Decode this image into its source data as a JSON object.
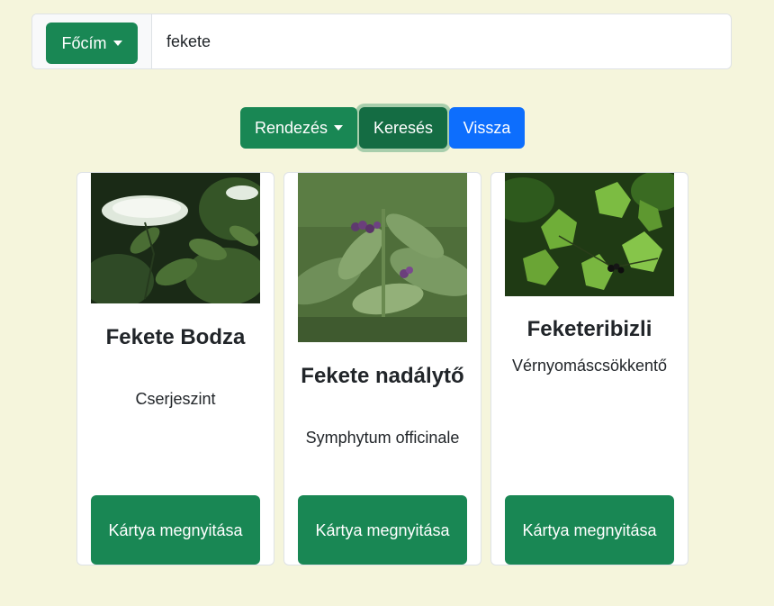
{
  "search": {
    "field_button_label": "Főcím",
    "query_value": "fekete",
    "placeholder": ""
  },
  "toolbar": {
    "sort_label": "Rendezés",
    "search_label": "Keresés",
    "back_label": "Vissza"
  },
  "cards": [
    {
      "title": "Fekete Bodza",
      "subtitle": "Cserjeszint",
      "button_label": "Kártya megnyitása"
    },
    {
      "title": "Fekete nadálytő",
      "subtitle": "Symphytum officinale",
      "button_label": "Kártya megnyitása"
    },
    {
      "title": "Feketeribizli",
      "subtitle": "Vérnyomáscsökkentő",
      "button_label": "Kártya megnyitása"
    }
  ],
  "colors": {
    "background": "#f5f5dc",
    "primary_green": "#198754",
    "active_green": "#146c43",
    "blue": "#0d6efd"
  }
}
